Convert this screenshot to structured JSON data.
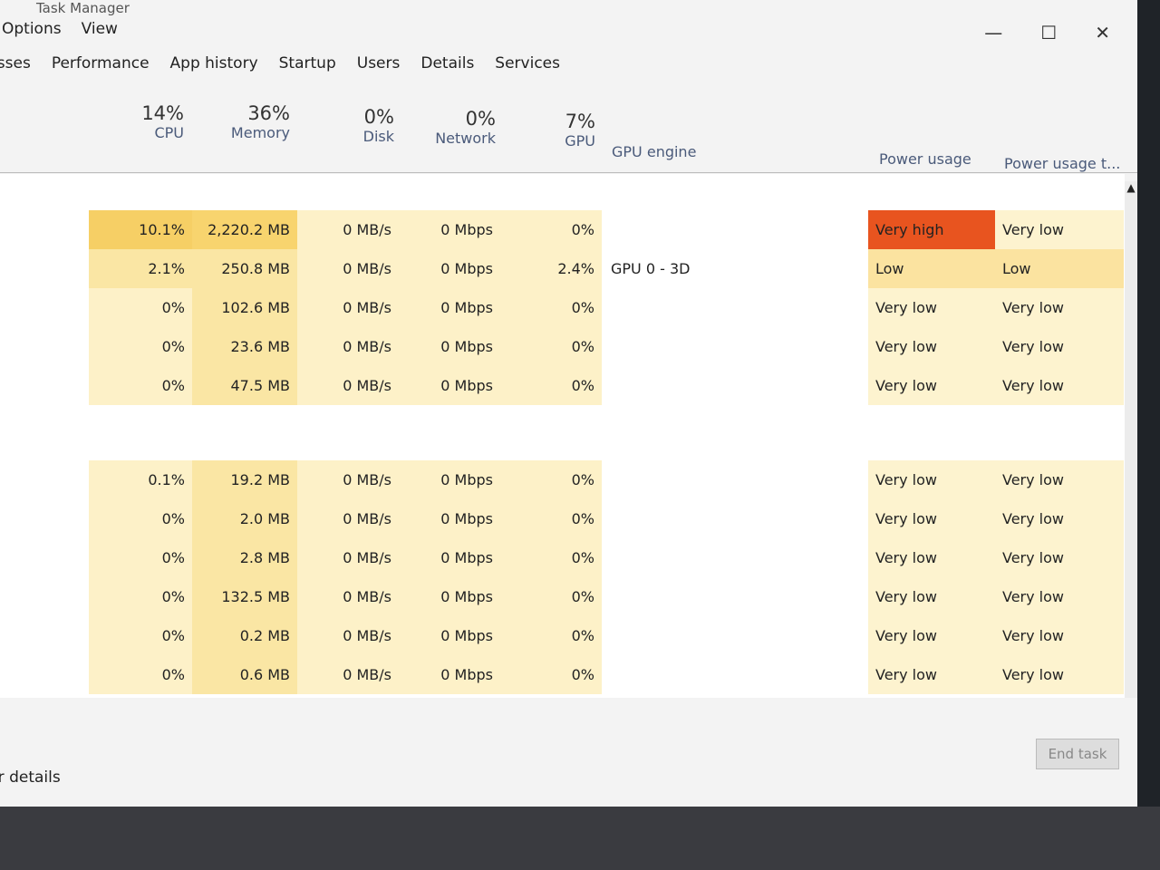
{
  "window": {
    "title": "Task Manager",
    "minimize": "—",
    "maximize": "☐",
    "close": "✕"
  },
  "menu": [
    "Options",
    "View"
  ],
  "tabs": [
    "Processes",
    "Performance",
    "App history",
    "Startup",
    "Users",
    "Details",
    "Services"
  ],
  "header": {
    "cpu": {
      "pct": "14%",
      "label": "CPU"
    },
    "memory": {
      "pct": "36%",
      "label": "Memory"
    },
    "disk": {
      "pct": "0%",
      "label": "Disk"
    },
    "network": {
      "pct": "0%",
      "label": "Network"
    },
    "gpu": {
      "pct": "7%",
      "label": "GPU"
    },
    "gpu_engine": "GPU engine",
    "power": "Power usage",
    "power_trend": "Power usage t..."
  },
  "groups": [
    [
      {
        "cpu": "10.1%",
        "mem": "2,220.2 MB",
        "disk": "0 MB/s",
        "net": "0 Mbps",
        "gpu": "0%",
        "engine": "",
        "power": "Very high",
        "trend": "Very low"
      },
      {
        "cpu": "2.1%",
        "mem": "250.8 MB",
        "disk": "0 MB/s",
        "net": "0 Mbps",
        "gpu": "2.4%",
        "engine": "GPU 0 - 3D",
        "power": "Low",
        "trend": "Low"
      },
      {
        "cpu": "0%",
        "mem": "102.6 MB",
        "disk": "0 MB/s",
        "net": "0 Mbps",
        "gpu": "0%",
        "engine": "",
        "power": "Very low",
        "trend": "Very low"
      },
      {
        "cpu": "0%",
        "mem": "23.6 MB",
        "disk": "0 MB/s",
        "net": "0 Mbps",
        "gpu": "0%",
        "engine": "",
        "power": "Very low",
        "trend": "Very low"
      },
      {
        "cpu": "0%",
        "mem": "47.5 MB",
        "disk": "0 MB/s",
        "net": "0 Mbps",
        "gpu": "0%",
        "engine": "",
        "power": "Very low",
        "trend": "Very low"
      }
    ],
    [
      {
        "cpu": "0.1%",
        "mem": "19.2 MB",
        "disk": "0 MB/s",
        "net": "0 Mbps",
        "gpu": "0%",
        "engine": "",
        "power": "Very low",
        "trend": "Very low"
      },
      {
        "cpu": "0%",
        "mem": "2.0 MB",
        "disk": "0 MB/s",
        "net": "0 Mbps",
        "gpu": "0%",
        "engine": "",
        "power": "Very low",
        "trend": "Very low"
      },
      {
        "cpu": "0%",
        "mem": "2.8 MB",
        "disk": "0 MB/s",
        "net": "0 Mbps",
        "gpu": "0%",
        "engine": "",
        "power": "Very low",
        "trend": "Very low"
      },
      {
        "cpu": "0%",
        "mem": "132.5 MB",
        "disk": "0 MB/s",
        "net": "0 Mbps",
        "gpu": "0%",
        "engine": "",
        "power": "Very low",
        "trend": "Very low"
      },
      {
        "cpu": "0%",
        "mem": "0.2 MB",
        "disk": "0 MB/s",
        "net": "0 Mbps",
        "gpu": "0%",
        "engine": "",
        "power": "Very low",
        "trend": "Very low"
      },
      {
        "cpu": "0%",
        "mem": "0.6 MB",
        "disk": "0 MB/s",
        "net": "0 Mbps",
        "gpu": "0%",
        "engine": "",
        "power": "Very low",
        "trend": "Very low"
      }
    ]
  ],
  "colors": {
    "very_high": "#e8541f",
    "low": "#fbe3a0",
    "very_low": "#fdf3cf",
    "cpu_high": "#f6cf65",
    "mem_high": "#f8d46e",
    "cell_light": "#fdf1c8",
    "cell_mid": "#fae6a4"
  },
  "footer": {
    "details": "Fewer details",
    "end_task": "End task"
  }
}
